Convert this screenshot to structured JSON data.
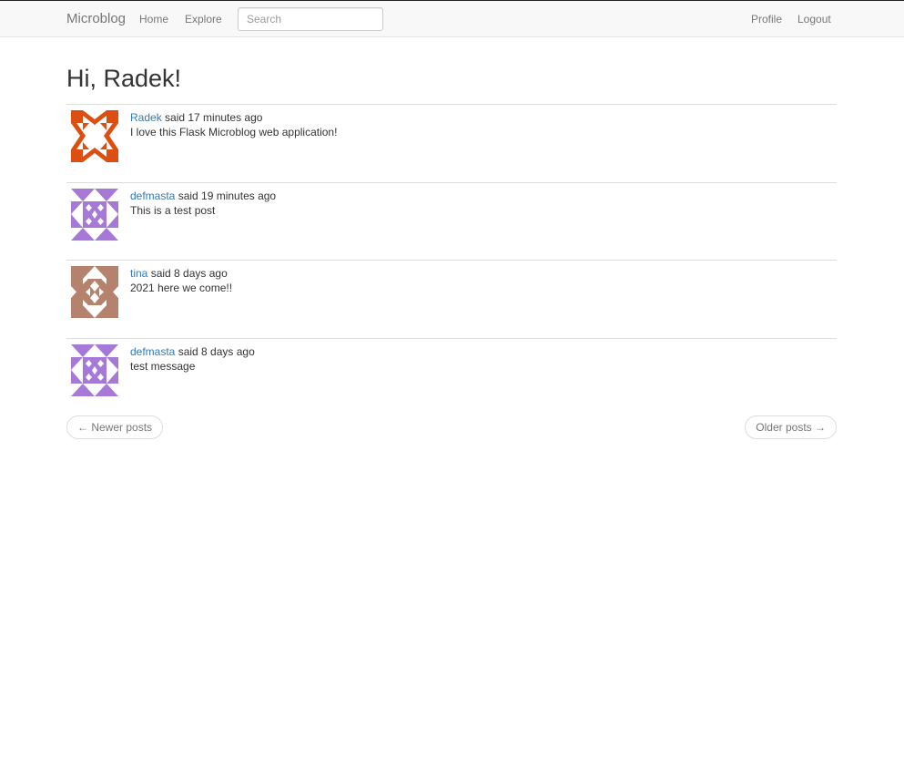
{
  "navbar": {
    "brand": "Microblog",
    "home": "Home",
    "explore": "Explore",
    "search_placeholder": "Search",
    "profile": "Profile",
    "logout": "Logout"
  },
  "greeting": "Hi, Radek!",
  "posts": [
    {
      "author": "Radek",
      "meta": " said 17 minutes ago",
      "body": "I love this Flask Microblog web application!",
      "avatar_color": "#dd4e11"
    },
    {
      "author": "defmasta",
      "meta": " said 19 minutes ago",
      "body": "This is a test post",
      "avatar_color": "#a679d6"
    },
    {
      "author": "tina",
      "meta": " said 8 days ago",
      "body": "2021 here we come!!",
      "avatar_color": "#b5826d"
    },
    {
      "author": "defmasta",
      "meta": " said 8 days ago",
      "body": "test message",
      "avatar_color": "#a679d6"
    }
  ],
  "pager": {
    "newer": "← Newer posts",
    "older": "Older posts →"
  }
}
